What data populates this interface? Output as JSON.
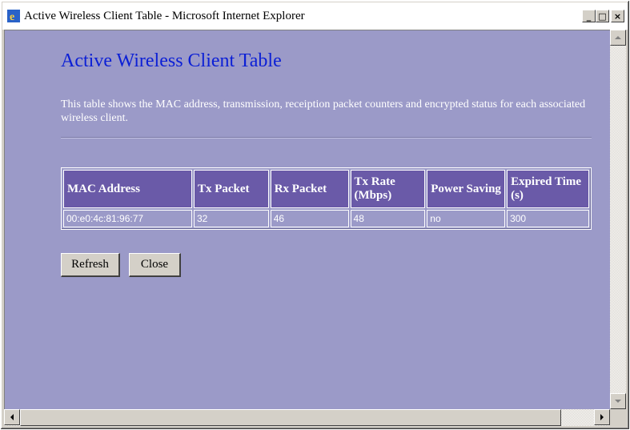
{
  "window": {
    "title": "Active Wireless Client Table - Microsoft Internet Explorer",
    "icon": "ie-icon",
    "controls": {
      "minimize": "_",
      "maximize": "□",
      "close": "×"
    }
  },
  "page": {
    "title": "Active Wireless Client Table",
    "description": "This table shows the MAC address, transmission, receiption packet counters and encrypted status for each associated wireless client."
  },
  "table": {
    "headers": {
      "mac": "MAC Address",
      "tx_packet": "Tx Packet",
      "rx_packet": "Rx Packet",
      "tx_rate": "Tx Rate (Mbps)",
      "power_saving": "Power Saving",
      "expired_time": "Expired Time (s)"
    },
    "rows": [
      {
        "mac": "00:e0:4c:81:96:77",
        "tx_packet": "32",
        "rx_packet": "46",
        "tx_rate": "48",
        "power_saving": "no",
        "expired_time": "300"
      }
    ]
  },
  "buttons": {
    "refresh": "Refresh",
    "close": "Close"
  },
  "colors": {
    "background": "#9b9ac8",
    "header_bg": "#6a5aa8",
    "title": "#0b1fd6"
  }
}
